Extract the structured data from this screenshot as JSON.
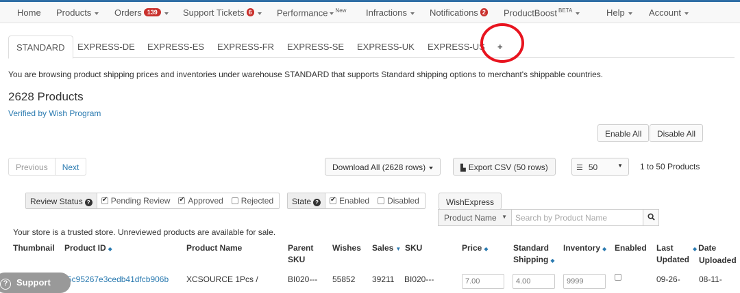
{
  "nav": {
    "home": "Home",
    "products": "Products",
    "orders": "Orders",
    "orders_badge": "139",
    "support_tickets": "Support Tickets",
    "support_badge": "6",
    "performance": "Performance",
    "performance_tag": "New",
    "infractions": "Infractions",
    "notifications": "Notifications",
    "notifications_badge": "2",
    "productboost": "ProductBoost",
    "productboost_tag": "BETA",
    "help": "Help",
    "account": "Account"
  },
  "tabs": [
    "STANDARD",
    "EXPRESS-DE",
    "EXPRESS-ES",
    "EXPRESS-FR",
    "EXPRESS-SE",
    "EXPRESS-UK",
    "EXPRESS-US",
    "+"
  ],
  "info_text": "You are browsing product shipping prices and inventories under warehouse STANDARD that supports Standard shipping options to merchant's shippable countries.",
  "product_count": "2628 Products",
  "verified_link": "Verified by Wish Program",
  "buttons": {
    "enable_all": "Enable All",
    "disable_all": "Disable All",
    "download_all": "Download All (2628 rows)",
    "export_csv": "Export CSV (50 rows)",
    "page_size": "50",
    "wishexpress": "WishExpress"
  },
  "pagination": {
    "previous": "Previous",
    "next": "Next",
    "range": "1 to 50 Products"
  },
  "filters": {
    "review_status": {
      "label": "Review Status",
      "options": [
        {
          "label": "Pending Review",
          "checked": true
        },
        {
          "label": "Approved",
          "checked": true
        },
        {
          "label": "Rejected",
          "checked": false
        }
      ]
    },
    "state": {
      "label": "State",
      "options": [
        {
          "label": "Enabled",
          "checked": true
        },
        {
          "label": "Disabled",
          "checked": false
        }
      ]
    }
  },
  "search": {
    "field": "Product Name",
    "placeholder": "Search by Product Name"
  },
  "trusted_text": "Your store is a trusted store. Unreviewed products are available for sale.",
  "table": {
    "headers": {
      "thumbnail": "Thumbnail",
      "product_id": "Product ID",
      "product_name": "Product Name",
      "parent_sku_1": "Parent",
      "parent_sku_2": "SKU",
      "wishes": "Wishes",
      "sales": "Sales",
      "sku": "SKU",
      "price": "Price",
      "std_ship_1": "Standard",
      "std_ship_2": "Shipping",
      "inventory": "Inventory",
      "enabled": "Enabled",
      "last_updated_1": "Last",
      "last_updated_2": "Updated",
      "date_uploaded_1": "Date",
      "date_uploaded_2": "Uploaded"
    },
    "row": {
      "product_id": "5c95267e3cedb41dfcb906b",
      "product_name": "XCSOURCE 1Pcs /",
      "parent_sku": "BI020---",
      "wishes": "55852",
      "sales": "39211",
      "sku": "BI020---",
      "price": "7.00",
      "shipping": "4.00",
      "inventory": "9999",
      "last_updated": "09-26-",
      "date_uploaded": "08-11-"
    }
  },
  "support_button": "Support"
}
